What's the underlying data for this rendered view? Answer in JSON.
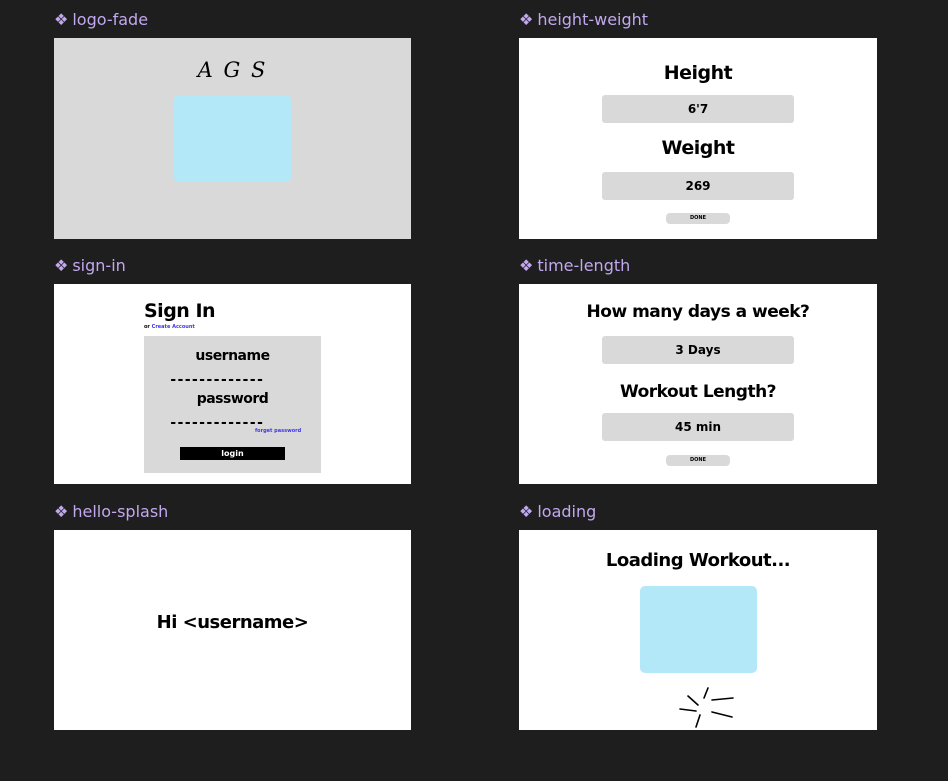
{
  "frames": {
    "logo_fade": {
      "label": "logo-fade",
      "logo_text": "A G S"
    },
    "height_weight": {
      "label": "height-weight",
      "height_heading": "Height",
      "height_value": "6'7",
      "weight_heading": "Weight",
      "weight_value": "269",
      "done_label": "DONE"
    },
    "sign_in": {
      "label": "sign-in",
      "title": "Sign In",
      "or_text": "or",
      "create_account": "Create Account",
      "username_label": "username",
      "username_line": "-------------",
      "password_label": "password",
      "password_line": "-------------",
      "forgot_password": "forget password",
      "login_label": "login"
    },
    "time_length": {
      "label": "time-length",
      "days_heading": "How many days a week?",
      "days_value": "3 Days",
      "length_heading": "Workout Length?",
      "length_value": "45 min",
      "done_label": "DONE"
    },
    "hello_splash": {
      "label": "hello-splash",
      "greeting": "Hi <username>"
    },
    "loading": {
      "label": "loading",
      "heading": "Loading Workout..."
    }
  },
  "icons": {
    "frame_marker": "component-diamond-icon",
    "loading": "spinner-icon"
  },
  "colors": {
    "canvas_bg": "#1e1e1e",
    "frame_label": "#c2a8ee",
    "frame_gray": "#d9d9d9",
    "placeholder_blue": "#b3e8f9",
    "link_blue": "#3d35e8",
    "button_black": "#000000"
  }
}
